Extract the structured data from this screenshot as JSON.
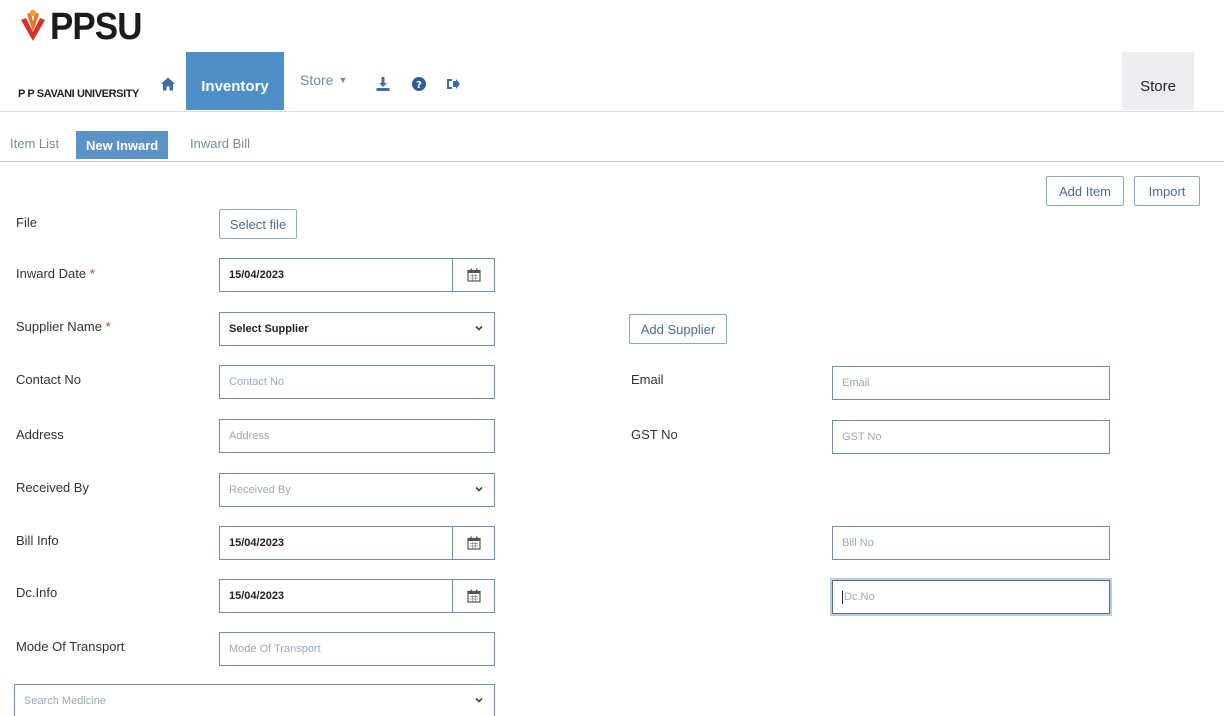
{
  "brand": {
    "name": "PPSU",
    "subtitle": "P P SAVANI UNIVERSITY"
  },
  "nav": {
    "inventory_label": "Inventory",
    "store_label": "Store",
    "right_label": "Store"
  },
  "tabs": [
    {
      "label": "Item List",
      "active": false
    },
    {
      "label": "New Inward",
      "active": true
    },
    {
      "label": "Inward Bill",
      "active": false
    }
  ],
  "actions": {
    "add_item": "Add Item",
    "import": "Import",
    "add_supplier": "Add Supplier",
    "select_file": "Select file"
  },
  "form": {
    "file_label": "File",
    "inward_date_label": "Inward Date",
    "inward_date_value": "15/04/2023",
    "supplier_label": "Supplier Name",
    "supplier_value": "Select Supplier",
    "contact_label": "Contact No",
    "contact_placeholder": "Contact No",
    "email_label": "Email",
    "email_placeholder": "Email",
    "address_label": "Address",
    "address_placeholder": "Address",
    "gst_label": "GST No",
    "gst_placeholder": "GST No",
    "received_label": "Received By",
    "received_placeholder": "Received By",
    "bill_label": "Bill Info",
    "bill_date": "15/04/2023",
    "bill_no_placeholder": "Bill No",
    "dc_label": "Dc.Info",
    "dc_date": "15/04/2023",
    "dc_no_placeholder": "Dc.No",
    "transport_label": "Mode Of Transport",
    "transport_placeholder": "Mode Of Transport",
    "search_placeholder": "Search Medicine",
    "required_mark": "*"
  },
  "colors": {
    "nav_active": "#4f8fc8",
    "tab_active": "#5b93c6",
    "field_border": "#6e8fb3",
    "required": "#c0392b"
  },
  "icons": [
    "home-icon",
    "download-icon",
    "help-icon",
    "logout-icon",
    "calendar-icon",
    "chevron-down-icon"
  ]
}
